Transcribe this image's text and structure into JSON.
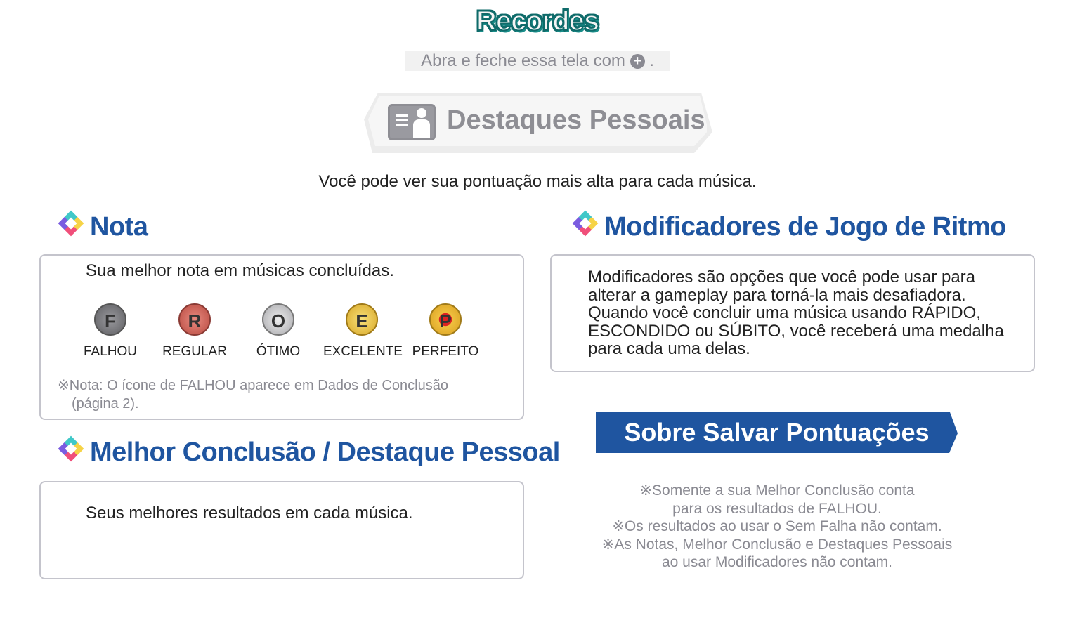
{
  "title": "Recordes",
  "hint": {
    "text": "Abra e feche essa tela com",
    "button_icon": "plus-button-icon",
    "end": "."
  },
  "banner": {
    "label": "Destaques Pessoais",
    "icon": "profile-card-icon"
  },
  "intro": "Você pode ver sua pontuação mais alta para cada música.",
  "nota": {
    "heading": "Nota",
    "description": "Sua melhor nota em músicas concluídas.",
    "medals": [
      {
        "letter": "F",
        "label": "FALHOU",
        "color": "#6e6e72"
      },
      {
        "letter": "R",
        "label": "REGULAR",
        "color": "#c8584e"
      },
      {
        "letter": "O",
        "label": "ÓTIMO",
        "color": "#b8b8bc"
      },
      {
        "letter": "E",
        "label": "EXCELENTE",
        "color": "#e8bf3a"
      },
      {
        "letter": "P",
        "label": "PERFEITO",
        "color": "#e8b43a"
      }
    ],
    "note_line1": "※Nota: O ícone de FALHOU aparece em Dados de Conclusão",
    "note_line2": "(página 2)."
  },
  "melhor": {
    "heading": "Melhor Conclusão / Destaque Pessoal",
    "description": "Seus melhores resultados em cada música."
  },
  "modificadores": {
    "heading": "Modificadores de Jogo de Ritmo",
    "lines": [
      "Modificadores são opções que você pode usar para",
      "alterar a gameplay para torná-la mais desafiadora.",
      "Quando você concluir uma música usando RÁPIDO,",
      "ESCONDIDO ou SÚBITO, você receberá uma medalha",
      "para cada uma delas."
    ]
  },
  "save": {
    "heading": "Sobre Salvar Pontuações",
    "notes": [
      "※Somente a sua Melhor Conclusão conta",
      "para os resultados de FALHOU.",
      "※Os resultados ao usar o Sem Falha não contam.",
      "※As Notas, Melhor Conclusão e Destaques Pessoais",
      "ao usar Modificadores não contam."
    ]
  }
}
